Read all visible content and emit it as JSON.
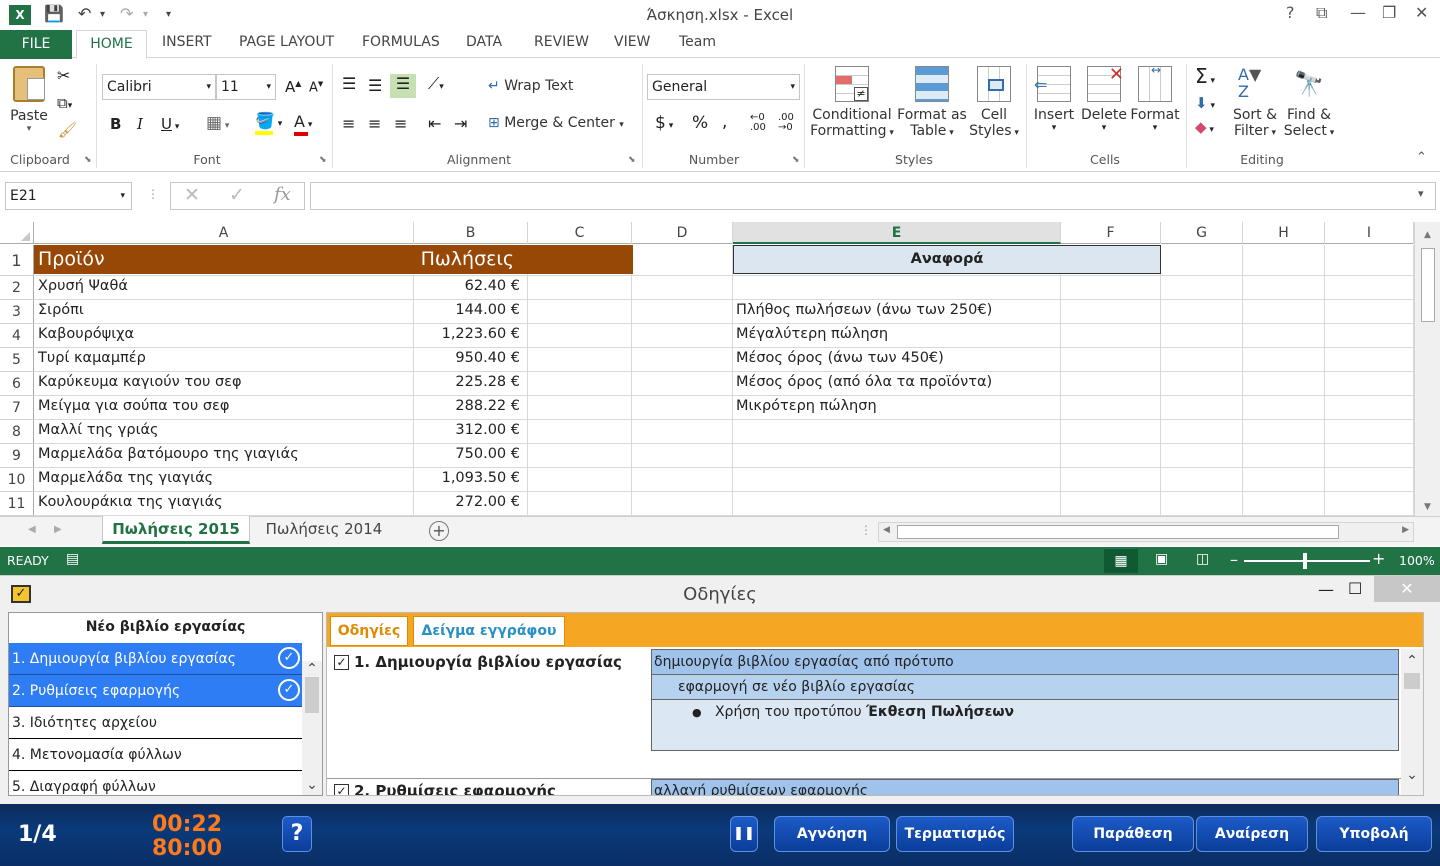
{
  "window": {
    "title": "Άσκηση.xlsx - Excel",
    "help": "?",
    "minimize": "—",
    "restore": "❐",
    "close": "✕"
  },
  "ribbon_tabs": [
    "FILE",
    "HOME",
    "INSERT",
    "PAGE LAYOUT",
    "FORMULAS",
    "DATA",
    "REVIEW",
    "VIEW",
    "Team"
  ],
  "clipboard": {
    "paste": "Paste",
    "label": "Clipboard"
  },
  "font": {
    "name": "Calibri",
    "size": "11",
    "label": "Font",
    "bold": "B",
    "italic": "I",
    "underline": "U"
  },
  "alignment": {
    "wrap": "Wrap Text",
    "merge": "Merge & Center",
    "label": "Alignment"
  },
  "number": {
    "format": "General",
    "currency": "$",
    "percent": "%",
    "comma": ",",
    "label": "Number"
  },
  "styles": {
    "conditional": [
      "Conditional",
      "Formatting"
    ],
    "format_table": [
      "Format as",
      "Table"
    ],
    "cell_styles": [
      "Cell",
      "Styles"
    ],
    "label": "Styles"
  },
  "cells": {
    "insert": "Insert",
    "delete": "Delete",
    "format": "Format",
    "label": "Cells"
  },
  "editing": {
    "sort": [
      "Sort &",
      "Filter"
    ],
    "find": [
      "Find &",
      "Select"
    ],
    "label": "Editing"
  },
  "formula_bar": {
    "name_box": "E21",
    "formula": "",
    "fx": "fx"
  },
  "columns": [
    "A",
    "B",
    "C",
    "D",
    "E",
    "F",
    "G",
    "H",
    "I"
  ],
  "header_row": {
    "A": "Προϊόν",
    "B": "Πωλήσεις",
    "E": "Αναφορά"
  },
  "rows": [
    {
      "n": "1"
    },
    {
      "n": "2",
      "A": "Χρυσή Ψαθά",
      "B": "62.40 €",
      "E": ""
    },
    {
      "n": "3",
      "A": "Σιρόπι",
      "B": "144.00 €",
      "E": "Πλήθος πωλήσεων (άνω των 250€)"
    },
    {
      "n": "4",
      "A": "Καβουρόψιχα",
      "B": "1,223.60 €",
      "E": "Μέγαλύτερη πώληση"
    },
    {
      "n": "5",
      "A": "Τυρί καμαμπέρ",
      "B": "950.40 €",
      "E": "Μέσος όρος (άνω των 450€)"
    },
    {
      "n": "6",
      "A": "Καρύκευμα καγιούν του σεφ",
      "B": "225.28 €",
      "E": "Μέσος όρος (από όλα τα προϊόντα)"
    },
    {
      "n": "7",
      "A": "Μείγμα για σούπα του σεφ",
      "B": "288.22 €",
      "E": "Μικρότερη πώληση"
    },
    {
      "n": "8",
      "A": "Μαλλί της γριάς",
      "B": "312.00 €",
      "E": ""
    },
    {
      "n": "9",
      "A": "Μαρμελάδα βατόμουρο της γιαγιάς",
      "B": "750.00 €",
      "E": ""
    },
    {
      "n": "10",
      "A": "Μαρμελάδα της γιαγιάς",
      "B": "1,093.50 €",
      "E": ""
    },
    {
      "n": "11",
      "A": "Κουλουράκια της γιαγιάς",
      "B": "272.00 €",
      "E": ""
    }
  ],
  "sheets": [
    "Πωλήσεις 2015",
    "Πωλήσεις 2014"
  ],
  "status": {
    "ready": "READY",
    "zoom": "100%"
  },
  "instructions": {
    "title": "Οδηγίες",
    "workbook_header": "Νέο βιβλίο εργασίας",
    "tasks": [
      "1. Δημιουργία βιβλίου εργασίας",
      "2. Ρυθμίσεις εφαρμογής",
      "3. Ιδιότητες αρχείου",
      "4. Μετονομασία φύλλων",
      "5. Διαγραφή φύλλων"
    ],
    "tabs": [
      "Οδηγίες",
      "Δείγμα εγγράφου"
    ],
    "step1_title": "1. Δημιουργία βιβλίου εργασίας",
    "step1_lines": [
      "δημιουργία βιβλίου εργασίας από πρότυπο",
      "εφαρμογή σε νέο βιβλίο εργασίας"
    ],
    "step1_bullet_prefix": "Χρήση του προτύπου ",
    "step1_bullet_bold": "Έκθεση Πωλήσεων",
    "step2_title": "2. Ρυθμίσεις εφαρμογής",
    "step2_line": "αλλαγή ρυθμίσεων εφαρμογής"
  },
  "bottom": {
    "progress": "1/4",
    "time_elapsed": "00:22",
    "time_total": "80:00",
    "help": "?",
    "pause": "❚❚",
    "ignore": "Αγνόηση",
    "finish": "Τερματισμός",
    "skip": "Παράθεση",
    "undo": "Αναίρεση",
    "submit": "Υποβολή"
  }
}
